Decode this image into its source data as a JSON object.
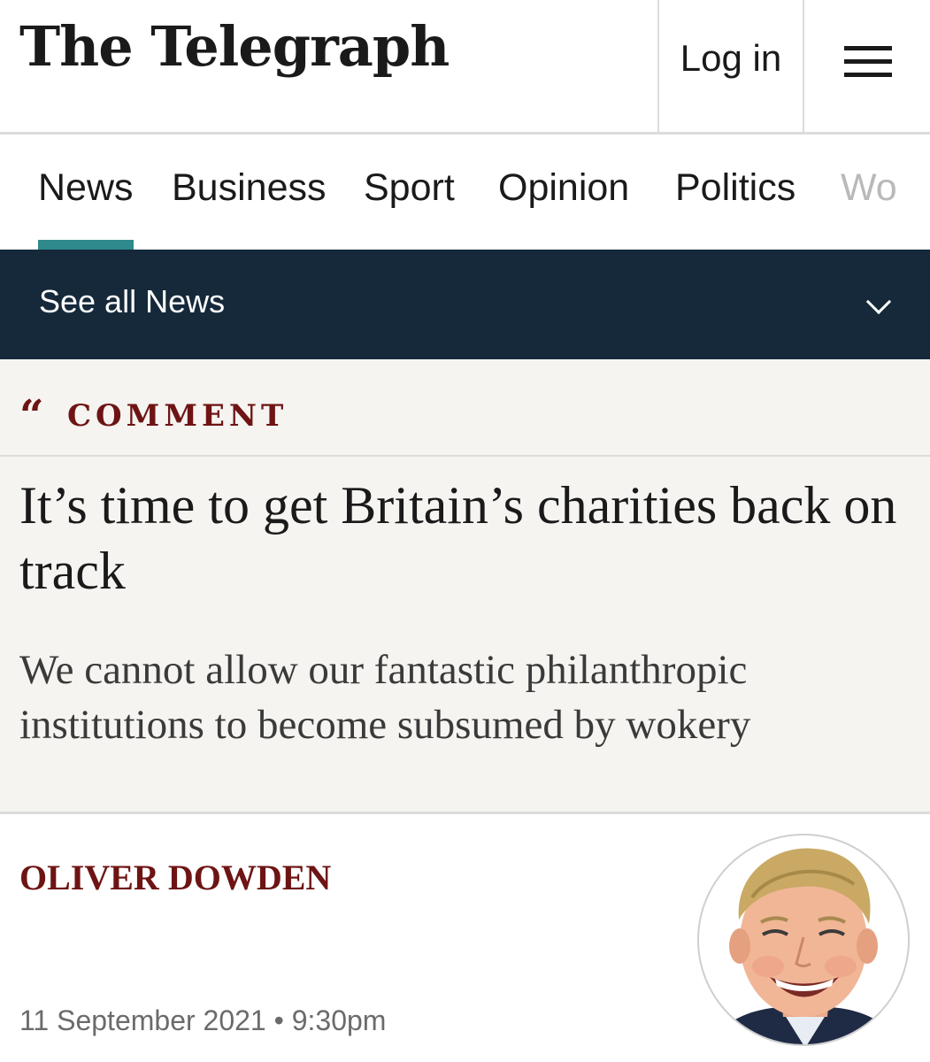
{
  "header": {
    "logo_text": "The Telegraph",
    "login_label": "Log in",
    "menu_icon": "hamburger-menu-icon"
  },
  "nav": {
    "items": [
      "News",
      "Business",
      "Sport",
      "Opinion",
      "Politics",
      "Wo"
    ],
    "active": "News",
    "active_color": "#2e8a8c"
  },
  "subnav": {
    "label": "See all News",
    "icon": "chevron-down-icon",
    "background": "#15293a"
  },
  "article": {
    "section_icon": "quote-icon",
    "section_label": "COMMENT",
    "headline": "It’s time to get Britain’s charities back on track",
    "standfirst": "We cannot allow our fantastic philanthropic institutions to become subsumed by wokery",
    "author": "OLIVER DOWDEN",
    "date": "11 September 2021 • 9:30pm",
    "accent_color": "#6e1414"
  }
}
